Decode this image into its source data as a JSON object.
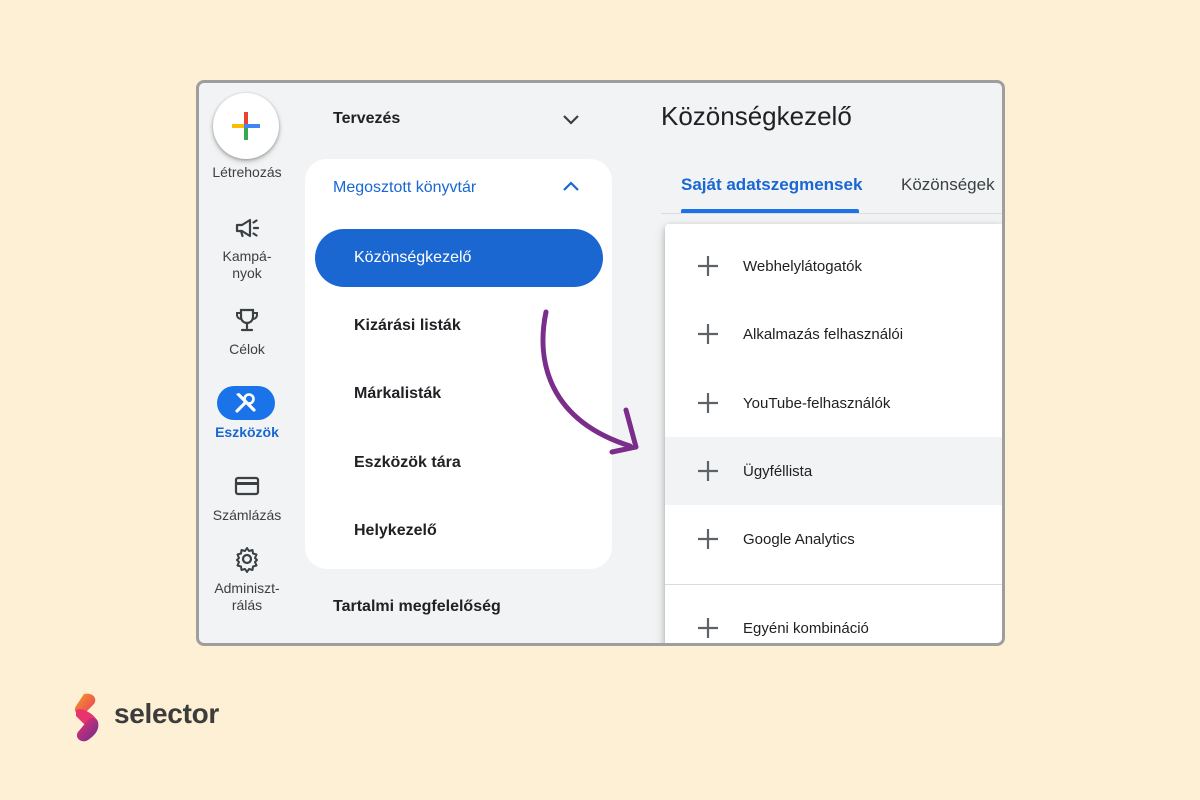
{
  "colors": {
    "background": "#fdf0d5",
    "primary": "#1a73e8",
    "primary_text": "#1967d2",
    "arrow": "#7b2d8b"
  },
  "rail": {
    "create_label": "Létrehozás",
    "items": [
      {
        "label": "Kampá-\nnyok",
        "icon": "megaphone-icon"
      },
      {
        "label": "Célok",
        "icon": "trophy-icon"
      },
      {
        "label": "Eszközök",
        "icon": "tools-icon",
        "active": true
      },
      {
        "label": "Számlázás",
        "icon": "credit-card-icon"
      },
      {
        "label": "Adminiszt-\nrálás",
        "icon": "gear-icon"
      }
    ]
  },
  "nav": {
    "planning": "Tervezés",
    "shared_library": "Megosztott könyvtár",
    "items": [
      "Közönségkezelő",
      "Kizárási listák",
      "Márkalisták",
      "Eszközök tára",
      "Helykezelő"
    ],
    "content_suitability": "Tartalmi megfelelőség"
  },
  "main": {
    "title": "Közönségkezelő",
    "tabs": [
      "Saját adatszegmensek",
      "Közönségek"
    ],
    "menu_items": [
      "Webhelylátogatók",
      "Alkalmazás felhasználói",
      "YouTube-felhasználók",
      "Ügyféllista",
      "Google Analytics",
      "Egyéni kombináció"
    ]
  },
  "logo": {
    "text": "selector"
  }
}
